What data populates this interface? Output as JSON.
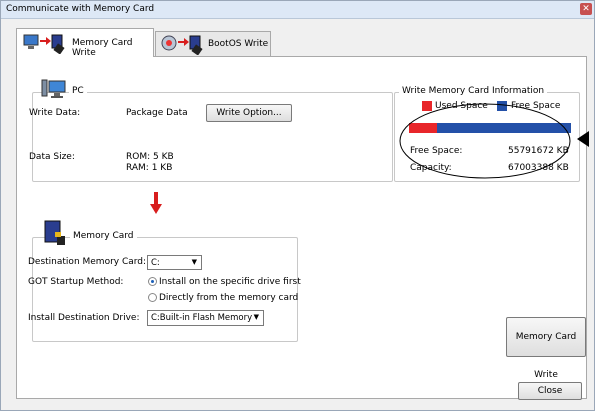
{
  "window": {
    "title": "Communicate with Memory Card",
    "close_glyph": "✕"
  },
  "tabs": [
    {
      "label": "Memory Card Write"
    },
    {
      "label": "BootOS Write"
    }
  ],
  "pc": {
    "title": "PC",
    "write_data_label": "Write Data:",
    "write_data_value": "Package Data",
    "write_option_button": "Write Option...",
    "data_size_label": "Data Size:",
    "rom": "ROM: 5 KB",
    "ram": "RAM: 1 KB"
  },
  "info": {
    "title": "Write Memory Card Information",
    "used_label": "Used Space",
    "free_label": "Free Space",
    "used_color": "#e8262a",
    "free_color": "#2350a8",
    "used_fraction": 0.17,
    "free_space_label": "Free Space:",
    "free_space_value": "55791672 KB",
    "capacity_label": "Capacity:",
    "capacity_value": "67003388 KB"
  },
  "arrow_color": "#d81e1e",
  "memory_card": {
    "title": "Memory Card",
    "dest_label": "Destination Memory Card:",
    "dest_value": "C:",
    "startup_label": "GOT Startup Method:",
    "startup_options": [
      "Install on the specific drive first",
      "Directly from the memory card"
    ],
    "startup_selected": 0,
    "install_label": "Install Destination Drive:",
    "install_value": "C:Built-in Flash Memory"
  },
  "buttons": {
    "memory_card_write": "Memory Card Write",
    "close": "Close"
  }
}
